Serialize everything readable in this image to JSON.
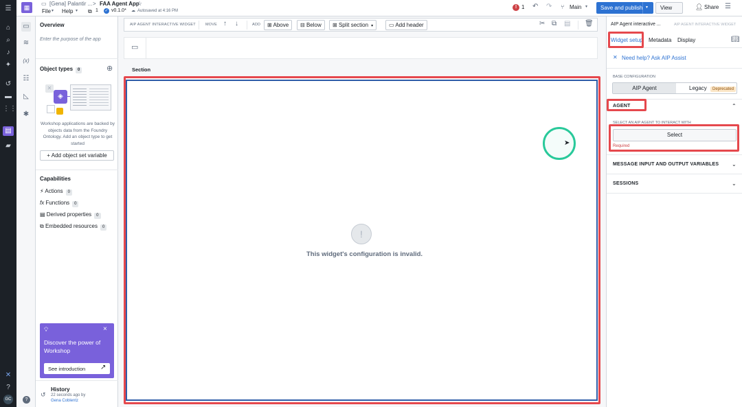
{
  "topbar": {
    "breadcrumb_parent": "[Gena] Palantir ...",
    "breadcrumb_sep": ">",
    "app_title": "FAA Agent App",
    "menu_file": "File",
    "menu_help": "Help",
    "pages_count": "1",
    "version": "v0.1.0*",
    "autosave": "Autosaved at 4:16 PM",
    "error_count": "1",
    "branch": "Main",
    "save_publish": "Save and publish",
    "view": "View",
    "share": "Share"
  },
  "sidepanel": {
    "overview_title": "Overview",
    "purpose_placeholder": "Enter the purpose of the app",
    "object_types_title": "Object types",
    "object_types_count": "0",
    "object_types_desc": "Workshop applications are backed by objects data from the Foundry Ontology. Add an object type to get started",
    "add_object_set": "Add object set variable",
    "capabilities_title": "Capabilities",
    "capabilities": [
      {
        "label": "Actions",
        "count": "0"
      },
      {
        "label": "Functions",
        "count": "0"
      },
      {
        "label": "Derived properties",
        "count": "0"
      },
      {
        "label": "Embedded resources",
        "count": "0"
      }
    ],
    "promo_title": "Discover the power of Workshop",
    "promo_button": "See introduction",
    "history_title": "History",
    "history_time": "22 seconds ago by",
    "history_user": "Gena Coblentz"
  },
  "toolbar": {
    "widget_label": "AIP AGENT INTERACTIVE WIDGET",
    "move_label": "MOVE",
    "add_label": "ADD",
    "above": "Above",
    "below": "Below",
    "split_section": "Split section",
    "add_header": "Add header"
  },
  "canvas": {
    "section_title": "Section",
    "invalid_msg": "This widget's configuration is invalid."
  },
  "rightpanel": {
    "header_title": "AIP Agent interactive ...",
    "header_sub": "AIP AGENT INTERACTIVE WIDGET",
    "tab_widget_setup": "Widget setup",
    "tab_metadata": "Metadata",
    "tab_display": "Display",
    "help_link": "Need help? Ask AIP Assist",
    "base_config_label": "BASE CONFIGURATION",
    "opt_aip_agent": "AIP Agent",
    "opt_legacy": "Legacy",
    "deprecated": "Deprecated",
    "agent_section": "AGENT",
    "select_agent_label": "SELECT AN AIP AGENT TO INTERACT WITH",
    "select_button": "Select",
    "required": "Required",
    "msg_io_section": "MESSAGE INPUT AND OUTPUT VARIABLES",
    "sessions_section": "SESSIONS"
  },
  "rail": {
    "user_initials": "GC"
  },
  "colors": {
    "accent": "#2d72d2",
    "highlight": "#e5484d",
    "rail": "#1c2127",
    "promo": "#7961db",
    "teal": "#29c99a"
  }
}
